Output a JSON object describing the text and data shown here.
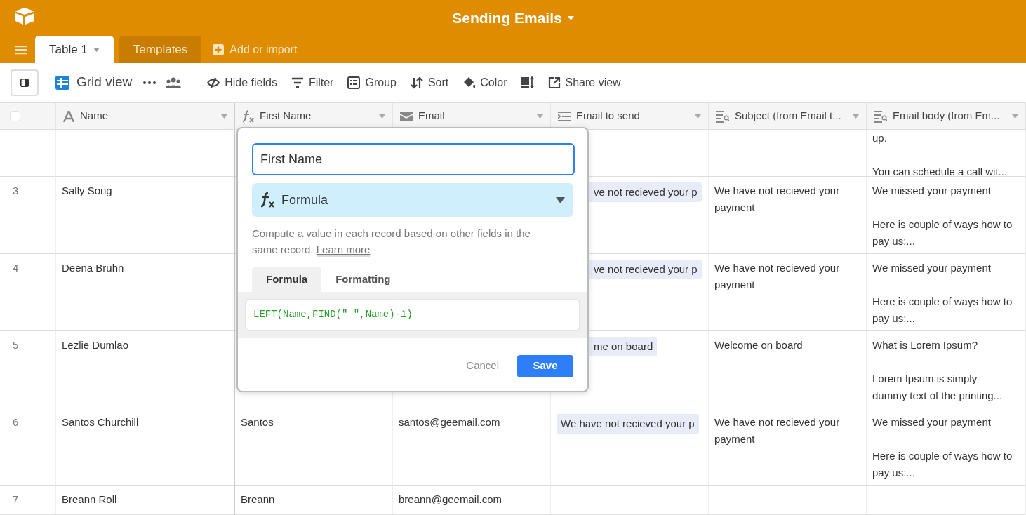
{
  "app": {
    "title": "Sending Emails"
  },
  "tabs": [
    {
      "label": "Table 1",
      "selected": true
    },
    {
      "label": "Templates",
      "selected": false
    }
  ],
  "add_import": "Add or import",
  "toolbar": [
    {
      "kind": "view",
      "label": "Grid view"
    },
    {
      "kind": "more"
    },
    {
      "kind": "people"
    },
    {
      "kind": "hide",
      "label": "Hide fields"
    },
    {
      "kind": "filter",
      "label": "Filter"
    },
    {
      "kind": "group",
      "label": "Group"
    },
    {
      "kind": "sort",
      "label": "Sort"
    },
    {
      "kind": "color",
      "label": "Color"
    },
    {
      "kind": "height"
    },
    {
      "kind": "share",
      "label": "Share view"
    }
  ],
  "select_all": {
    "checked": false
  },
  "columns": [
    {
      "kind": "text",
      "label": "Name"
    },
    {
      "kind": "formula",
      "label": "First Name"
    },
    {
      "kind": "email",
      "label": "Email"
    },
    {
      "kind": "link",
      "label": "Email to send"
    },
    {
      "kind": "lookup",
      "label": "Subject (from Email t..."
    },
    {
      "kind": "lookup",
      "label": "Email body (from Em..."
    }
  ],
  "rows": [
    {
      "email_body": [
        "up.",
        "You can schedule a call wit..."
      ]
    },
    {
      "number": "3",
      "name": "Sally Song",
      "email_to_send": {
        "text": "ve not recieved your p",
        "partial": true
      },
      "subject": "We have not recieved your payment",
      "email_body": [
        "We missed your payment",
        "Here is couple of ways how to pay us:..."
      ]
    },
    {
      "number": "4",
      "name": "Deena Bruhn",
      "email_to_send": {
        "text": "ve not recieved your p",
        "partial": true
      },
      "subject": "We have not recieved your payment",
      "email_body": [
        "We missed your payment",
        "Here is couple of ways how to pay us:..."
      ]
    },
    {
      "number": "5",
      "name": "Lezlie Dumlao",
      "email_to_send": {
        "text": "me on board",
        "partial": true
      },
      "subject": "Welcome on board",
      "email_body": [
        "What is Lorem Ipsum?",
        "Lorem Ipsum is simply dummy text of the printing..."
      ]
    },
    {
      "number": "6",
      "name": "Santos Churchill",
      "first_name": "Santos",
      "email": "santos@geemail.com",
      "email_to_send": {
        "text": "We have not recieved your p",
        "partial": false
      },
      "subject": "We have not recieved your payment",
      "email_body": [
        "We missed your payment",
        "Here is couple of ways how to pay us:..."
      ]
    },
    {
      "number": "7",
      "name": "Breann Roll",
      "first_name": "Breann",
      "email": "breann@geemail.com"
    }
  ],
  "field_editor": {
    "field_name": "First Name",
    "field_type": "Formula",
    "description": "Compute a value in each record based on other fields in the same record.",
    "learn_more": "Learn more",
    "tabs": [
      {
        "label": "Formula",
        "selected": true
      },
      {
        "label": "Formatting",
        "selected": false
      }
    ],
    "formula": "LEFT(Name,FIND(\" \",Name)-1)",
    "buttons": [
      {
        "kind": "cancel",
        "label": "Cancel"
      },
      {
        "kind": "save",
        "label": "Save"
      }
    ]
  }
}
